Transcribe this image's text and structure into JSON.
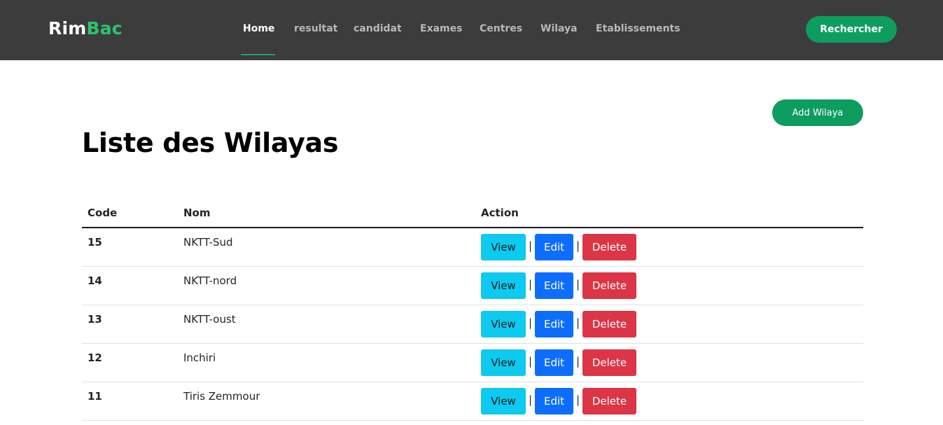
{
  "brand": {
    "part1": "Rim",
    "part2": "Bac"
  },
  "nav": {
    "items": [
      {
        "label": "Home",
        "active": true
      },
      {
        "label": "resultat",
        "active": false
      },
      {
        "label": "candidat",
        "active": false
      },
      {
        "label": "Exames",
        "active": false
      },
      {
        "label": "Centres",
        "active": false
      },
      {
        "label": "Wilaya",
        "active": false
      },
      {
        "label": "Etablissements",
        "active": false
      }
    ],
    "search_label": "Rechercher"
  },
  "page": {
    "title": "Liste des Wilayas",
    "add_label": "Add Wilaya"
  },
  "table": {
    "headers": {
      "code": "Code",
      "nom": "Nom",
      "action": "Action"
    },
    "action_labels": {
      "view": "View",
      "edit": "Edit",
      "delete": "Delete",
      "separator": "|"
    },
    "rows": [
      {
        "code": "15",
        "nom": "NKTT-Sud"
      },
      {
        "code": "14",
        "nom": "NKTT-nord"
      },
      {
        "code": "13",
        "nom": "NKTT-oust"
      },
      {
        "code": "12",
        "nom": "Inchiri"
      },
      {
        "code": "11",
        "nom": "Tiris Zemmour"
      }
    ]
  },
  "colors": {
    "navbar_bg": "#3c3c3c",
    "brand_accent": "#2ec46a",
    "primary_green": "#0d9d5e",
    "view_btn": "#0dcaf0",
    "edit_btn": "#0d6efd",
    "delete_btn": "#dc3545"
  }
}
